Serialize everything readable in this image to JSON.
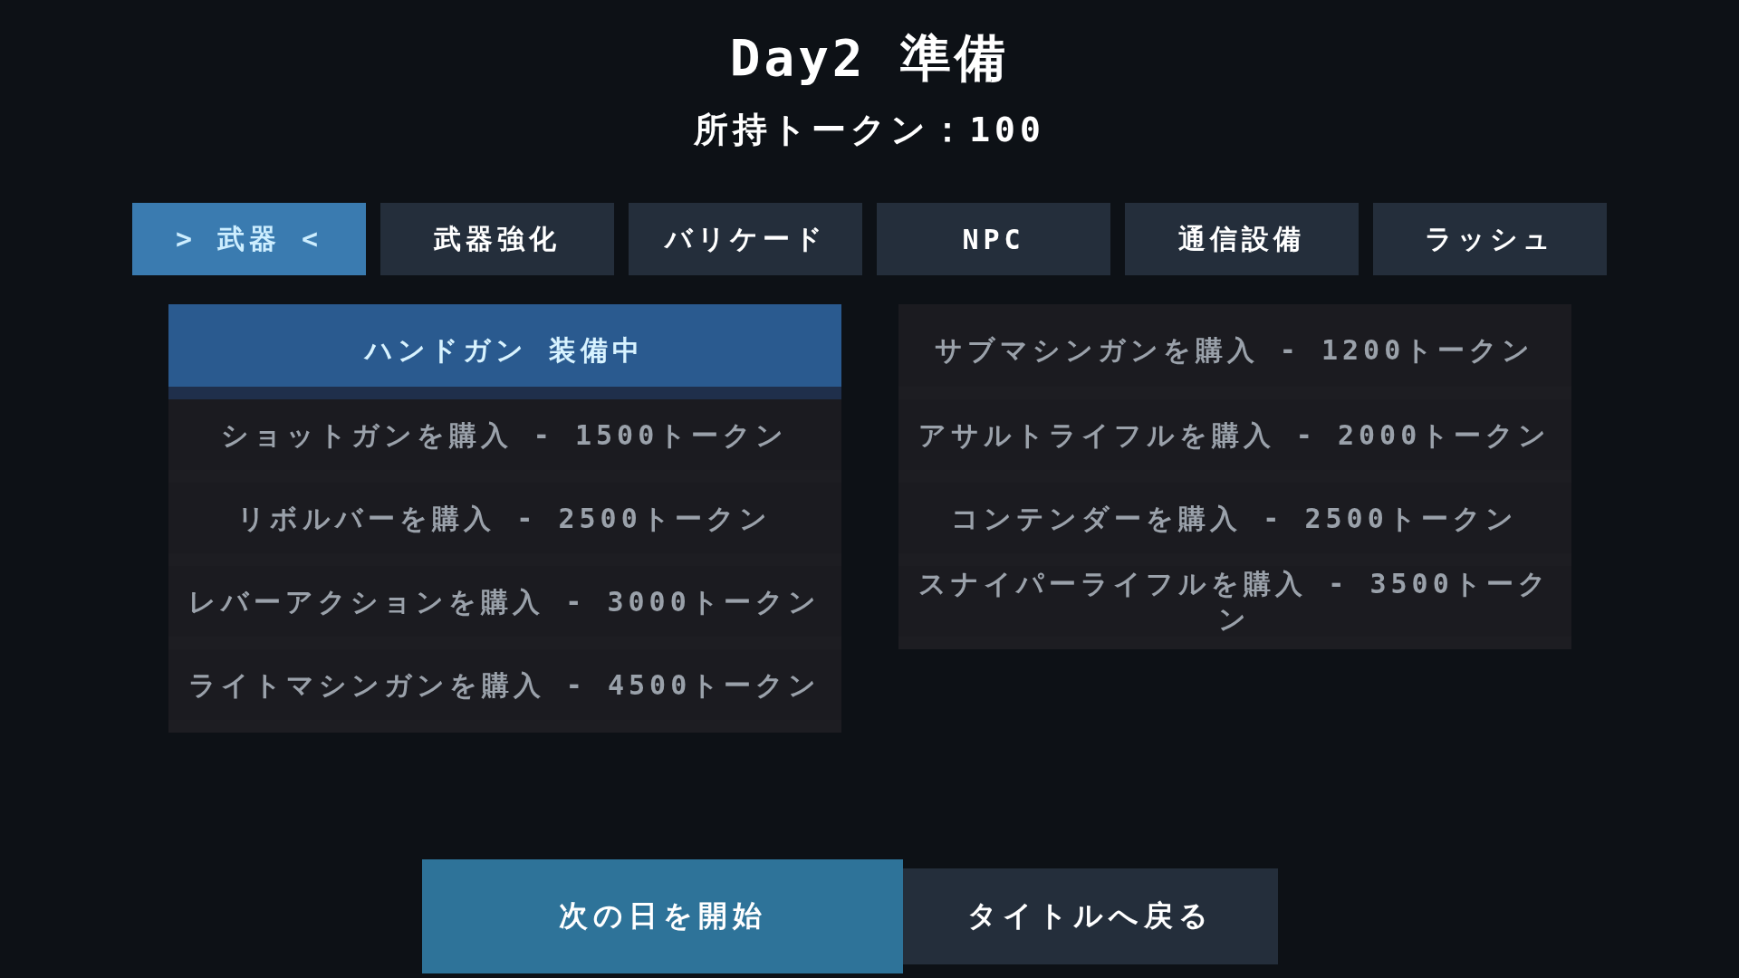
{
  "header": {
    "title": "Day2 準備",
    "tokens": "所持トークン：100"
  },
  "tabs": [
    {
      "label": "> 武器 <",
      "selected": true
    },
    {
      "label": "武器強化",
      "selected": false
    },
    {
      "label": "バリケード",
      "selected": false
    },
    {
      "label": "NPC",
      "selected": false
    },
    {
      "label": "通信設備",
      "selected": false
    },
    {
      "label": "ラッシュ",
      "selected": false
    }
  ],
  "item_columns": [
    {
      "items": [
        {
          "label": "ハンドガン 装備中",
          "equipped": true
        },
        {
          "label": "ショットガンを購入 - 1500トークン",
          "equipped": false
        },
        {
          "label": "リボルバーを購入 - 2500トークン",
          "equipped": false
        },
        {
          "label": "レバーアクションを購入 - 3000トークン",
          "equipped": false
        },
        {
          "label": "ライトマシンガンを購入 - 4500トークン",
          "equipped": false
        }
      ]
    },
    {
      "items": [
        {
          "label": "サブマシンガンを購入 - 1200トークン",
          "equipped": false
        },
        {
          "label": "アサルトライフルを購入 - 2000トークン",
          "equipped": false
        },
        {
          "label": "コンテンダーを購入 - 2500トークン",
          "equipped": false
        },
        {
          "label": "スナイパーライフルを購入 - 3500トークン",
          "equipped": false
        }
      ]
    }
  ],
  "buttons": [
    {
      "label": "次の日を開始",
      "focused": true
    },
    {
      "label": "タイトルへ戻る",
      "focused": false
    }
  ]
}
